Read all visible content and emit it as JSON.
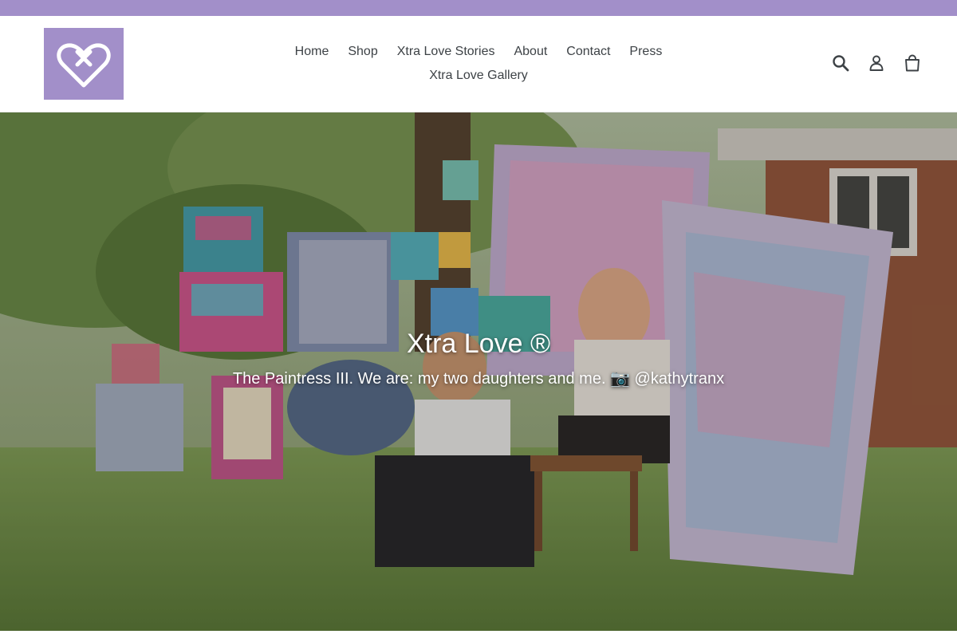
{
  "brand": {
    "logo_icon": "heart-x-icon",
    "logo_color": "#a28fc9",
    "accent_color": "#a28fc9"
  },
  "nav": {
    "row1": [
      {
        "label": "Home"
      },
      {
        "label": "Shop"
      },
      {
        "label": "Xtra Love Stories"
      },
      {
        "label": "About"
      },
      {
        "label": "Contact"
      },
      {
        "label": "Press"
      }
    ],
    "row2": [
      {
        "label": "Xtra Love Gallery"
      }
    ]
  },
  "header_icons": {
    "search": "search-icon",
    "account": "user-icon",
    "cart": "cart-icon"
  },
  "hero": {
    "title": "Xtra Love ®",
    "subtitle": "The Paintress III. We are: my two daughters and me. 📷 @kathytranx",
    "image_icon": "hero-photo"
  }
}
